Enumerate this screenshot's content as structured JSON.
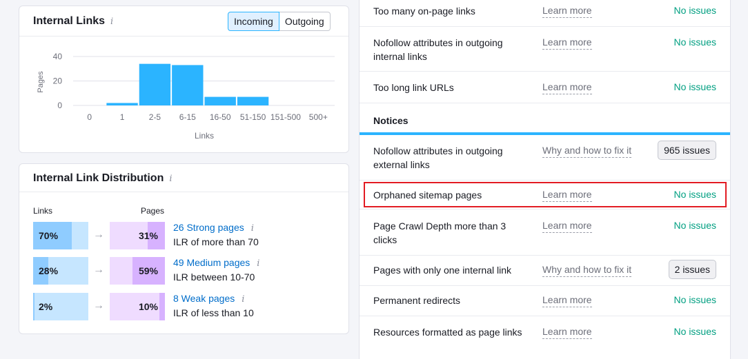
{
  "internal_links": {
    "title": "Internal Links",
    "info_icon": "i",
    "toggle": {
      "incoming": "Incoming",
      "outgoing": "Outgoing",
      "active": "incoming"
    },
    "chart_data": {
      "type": "bar",
      "categories": [
        "0",
        "1",
        "2-5",
        "6-15",
        "16-50",
        "51-150",
        "151-500",
        "500+"
      ],
      "values": [
        0,
        2,
        34,
        33,
        7,
        7,
        0,
        0
      ],
      "xlabel": "Links",
      "ylabel": "Pages",
      "ylim": [
        0,
        40
      ],
      "yticks": [
        0,
        20,
        40
      ],
      "grid": true,
      "color": "#2bb4ff"
    }
  },
  "distribution": {
    "title": "Internal Link Distribution",
    "info_icon": "i",
    "col_links": "Links",
    "col_pages": "Pages",
    "rows": [
      {
        "links_pct": "70%",
        "links_frac": 0.7,
        "pages_pct": "31%",
        "pages_frac": 0.31,
        "label": "26 Strong pages",
        "sub": "ILR of more than 70"
      },
      {
        "links_pct": "28%",
        "links_frac": 0.28,
        "pages_pct": "59%",
        "pages_frac": 0.59,
        "label": "49 Medium pages",
        "sub": "ILR between 10-70"
      },
      {
        "links_pct": "2%",
        "links_frac": 0.02,
        "pages_pct": "10%",
        "pages_frac": 0.1,
        "label": "8 Weak pages",
        "sub": "ILR of less than 10"
      }
    ]
  },
  "issues": {
    "warnings": [
      {
        "name": "Too many on-page links",
        "link": "Learn more",
        "status": "No issues"
      },
      {
        "name": "Nofollow attributes in outgoing internal links",
        "link": "Learn more",
        "status": "No issues"
      },
      {
        "name": "Too long link URLs",
        "link": "Learn more",
        "status": "No issues"
      }
    ],
    "notices_title": "Notices",
    "notices": [
      {
        "name": "Nofollow attributes in outgoing external links",
        "link": "Why and how to fix it",
        "badge": "965 issues"
      },
      {
        "name": "Orphaned sitemap pages",
        "link": "Learn more",
        "status": "No issues"
      },
      {
        "name": "Page Crawl Depth more than 3 clicks",
        "link": "Learn more",
        "status": "No issues"
      },
      {
        "name": "Pages with only one internal link",
        "link": "Why and how to fix it",
        "badge": "2 issues"
      },
      {
        "name": "Permanent redirects",
        "link": "Learn more",
        "status": "No issues"
      },
      {
        "name": "Resources formatted as page links",
        "link": "Learn more",
        "status": "No issues"
      }
    ]
  },
  "colors": {
    "accent": "#2bb4ff",
    "link": "#006dca",
    "success": "#009f81",
    "highlight": "#e21a22"
  }
}
